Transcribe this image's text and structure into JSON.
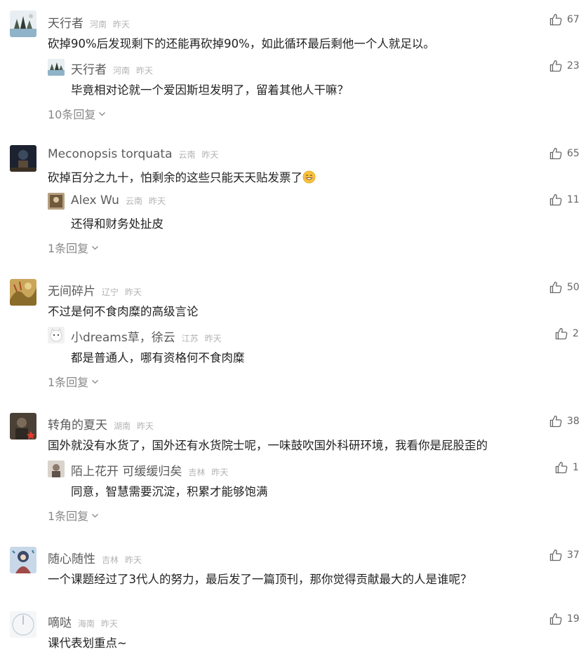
{
  "comments": [
    {
      "name": "天行者",
      "location": "河南",
      "time": "昨天",
      "likes": "67",
      "text": "砍掉90%后发现剩下的还能再砍掉90%，如此循环最后剩他一个人就足以。",
      "reply": {
        "name": "天行者",
        "location": "河南",
        "time": "昨天",
        "likes": "23",
        "text": "毕竟相对论就一个爱因斯坦发明了，留着其他人干嘛？"
      },
      "more": "10条回复"
    },
    {
      "name": "Meconopsis torquata",
      "location": "云南",
      "time": "昨天",
      "likes": "65",
      "text": "砍掉百分之九十，怕剩余的这些只能天天贴发票了",
      "reply": {
        "name": "Alex Wu",
        "location": "云南",
        "time": "昨天",
        "likes": "11",
        "text": "还得和财务处扯皮"
      },
      "more": "1条回复"
    },
    {
      "name": "无间碎片",
      "location": "辽宁",
      "time": "昨天",
      "likes": "50",
      "text": "不过是何不食肉糜的高级言论",
      "reply": {
        "name": "小dreams草，徐云",
        "location": "江苏",
        "time": "昨天",
        "likes": "2",
        "text": "都是普通人，哪有资格何不食肉糜"
      },
      "more": "1条回复"
    },
    {
      "name": "转角的夏天",
      "location": "湖南",
      "time": "昨天",
      "likes": "38",
      "text": "国外就没有水货了，国外还有水货院士呢，一味鼓吹国外科研环境，我看你是屁股歪的",
      "reply": {
        "name": "陌上花开 可缓缓归矣",
        "location": "吉林",
        "time": "昨天",
        "likes": "1",
        "text": "同意，智慧需要沉淀，积累才能够饱满"
      },
      "more": "1条回复"
    },
    {
      "name": "随心随性",
      "location": "吉林",
      "time": "昨天",
      "likes": "37",
      "text": "一个课题经过了3代人的努力，最后发了一篇顶刊，那你觉得贡献最大的人是谁呢？"
    },
    {
      "name": "嘀哒",
      "location": "海南",
      "time": "昨天",
      "likes": "19",
      "text": "课代表划重点~"
    }
  ]
}
